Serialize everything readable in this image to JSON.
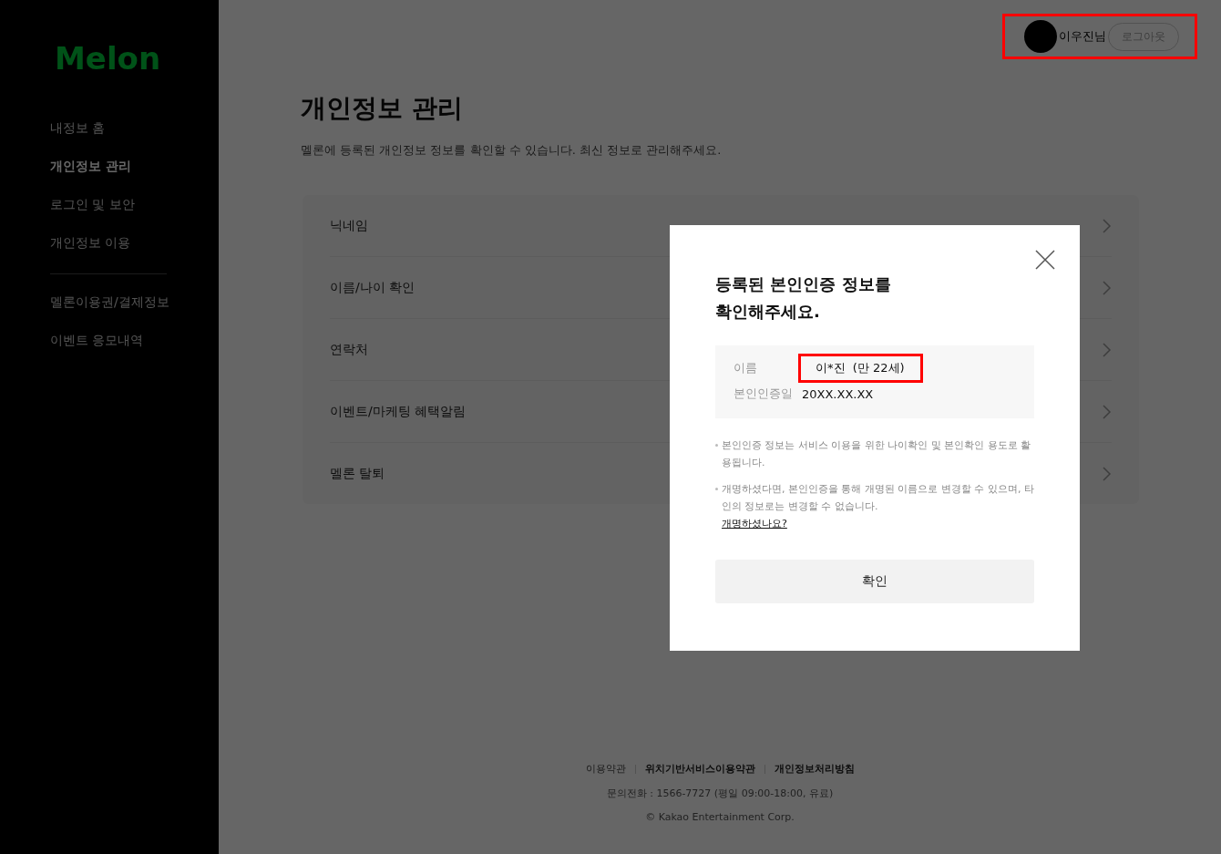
{
  "sidebar": {
    "logo": "Melon",
    "nav_groups": [
      [
        {
          "label": "내정보 홈",
          "selected": false
        },
        {
          "label": "개인정보 관리",
          "selected": true
        },
        {
          "label": "로그인 및 보안",
          "selected": false
        },
        {
          "label": "개인정보 이용",
          "selected": false
        }
      ],
      [
        {
          "label": "멜론이용권/결제정보",
          "selected": false
        },
        {
          "label": "이벤트 응모내역",
          "selected": false
        }
      ]
    ]
  },
  "header": {
    "user_name": "이우진님",
    "logout": "로그아웃",
    "highlighted": true
  },
  "page": {
    "title": "개인정보 관리",
    "description": "멜론에 등록된 개인정보 정보를 확인할 수 있습니다. 최신 정보로 관리해주세요.",
    "items": [
      "닉네임",
      "이름/나이 확인",
      "연락처",
      "이벤트/마케팅 혜택알림",
      "멜론 탈퇴"
    ]
  },
  "modal": {
    "title_lines": [
      "등록된 본인인증 정보를",
      "확인해주세요."
    ],
    "info_rows": [
      {
        "label": "이름",
        "value": "이*진  (만 22세)",
        "highlighted": true
      },
      {
        "label": "본인인증일",
        "value": "20XX.XX.XX",
        "highlighted": false
      }
    ],
    "notes": [
      {
        "text": "본인인증 정보는 서비스 이용을 위한 나이확인 및 본인확인 용도로 활용됩니다."
      },
      {
        "text": "개명하셨다면, 본인인증을 통해 개명된 이름으로 변경할 수 있으며, 타인의 정보로는 변경할 수 없습니다.",
        "link": "개명하셨나요?"
      }
    ],
    "confirm": "확인"
  },
  "footer": {
    "links": [
      {
        "label": "이용약관",
        "emphasized": false
      },
      {
        "label": "위치기반서비스이용약관",
        "emphasized": true
      },
      {
        "label": "개인정보처리방침",
        "emphasized": true
      }
    ],
    "contact": "문의전화 : 1566-7727 (평일 09:00-18:00, 유료)",
    "copyright": "© Kakao Entertainment Corp."
  }
}
